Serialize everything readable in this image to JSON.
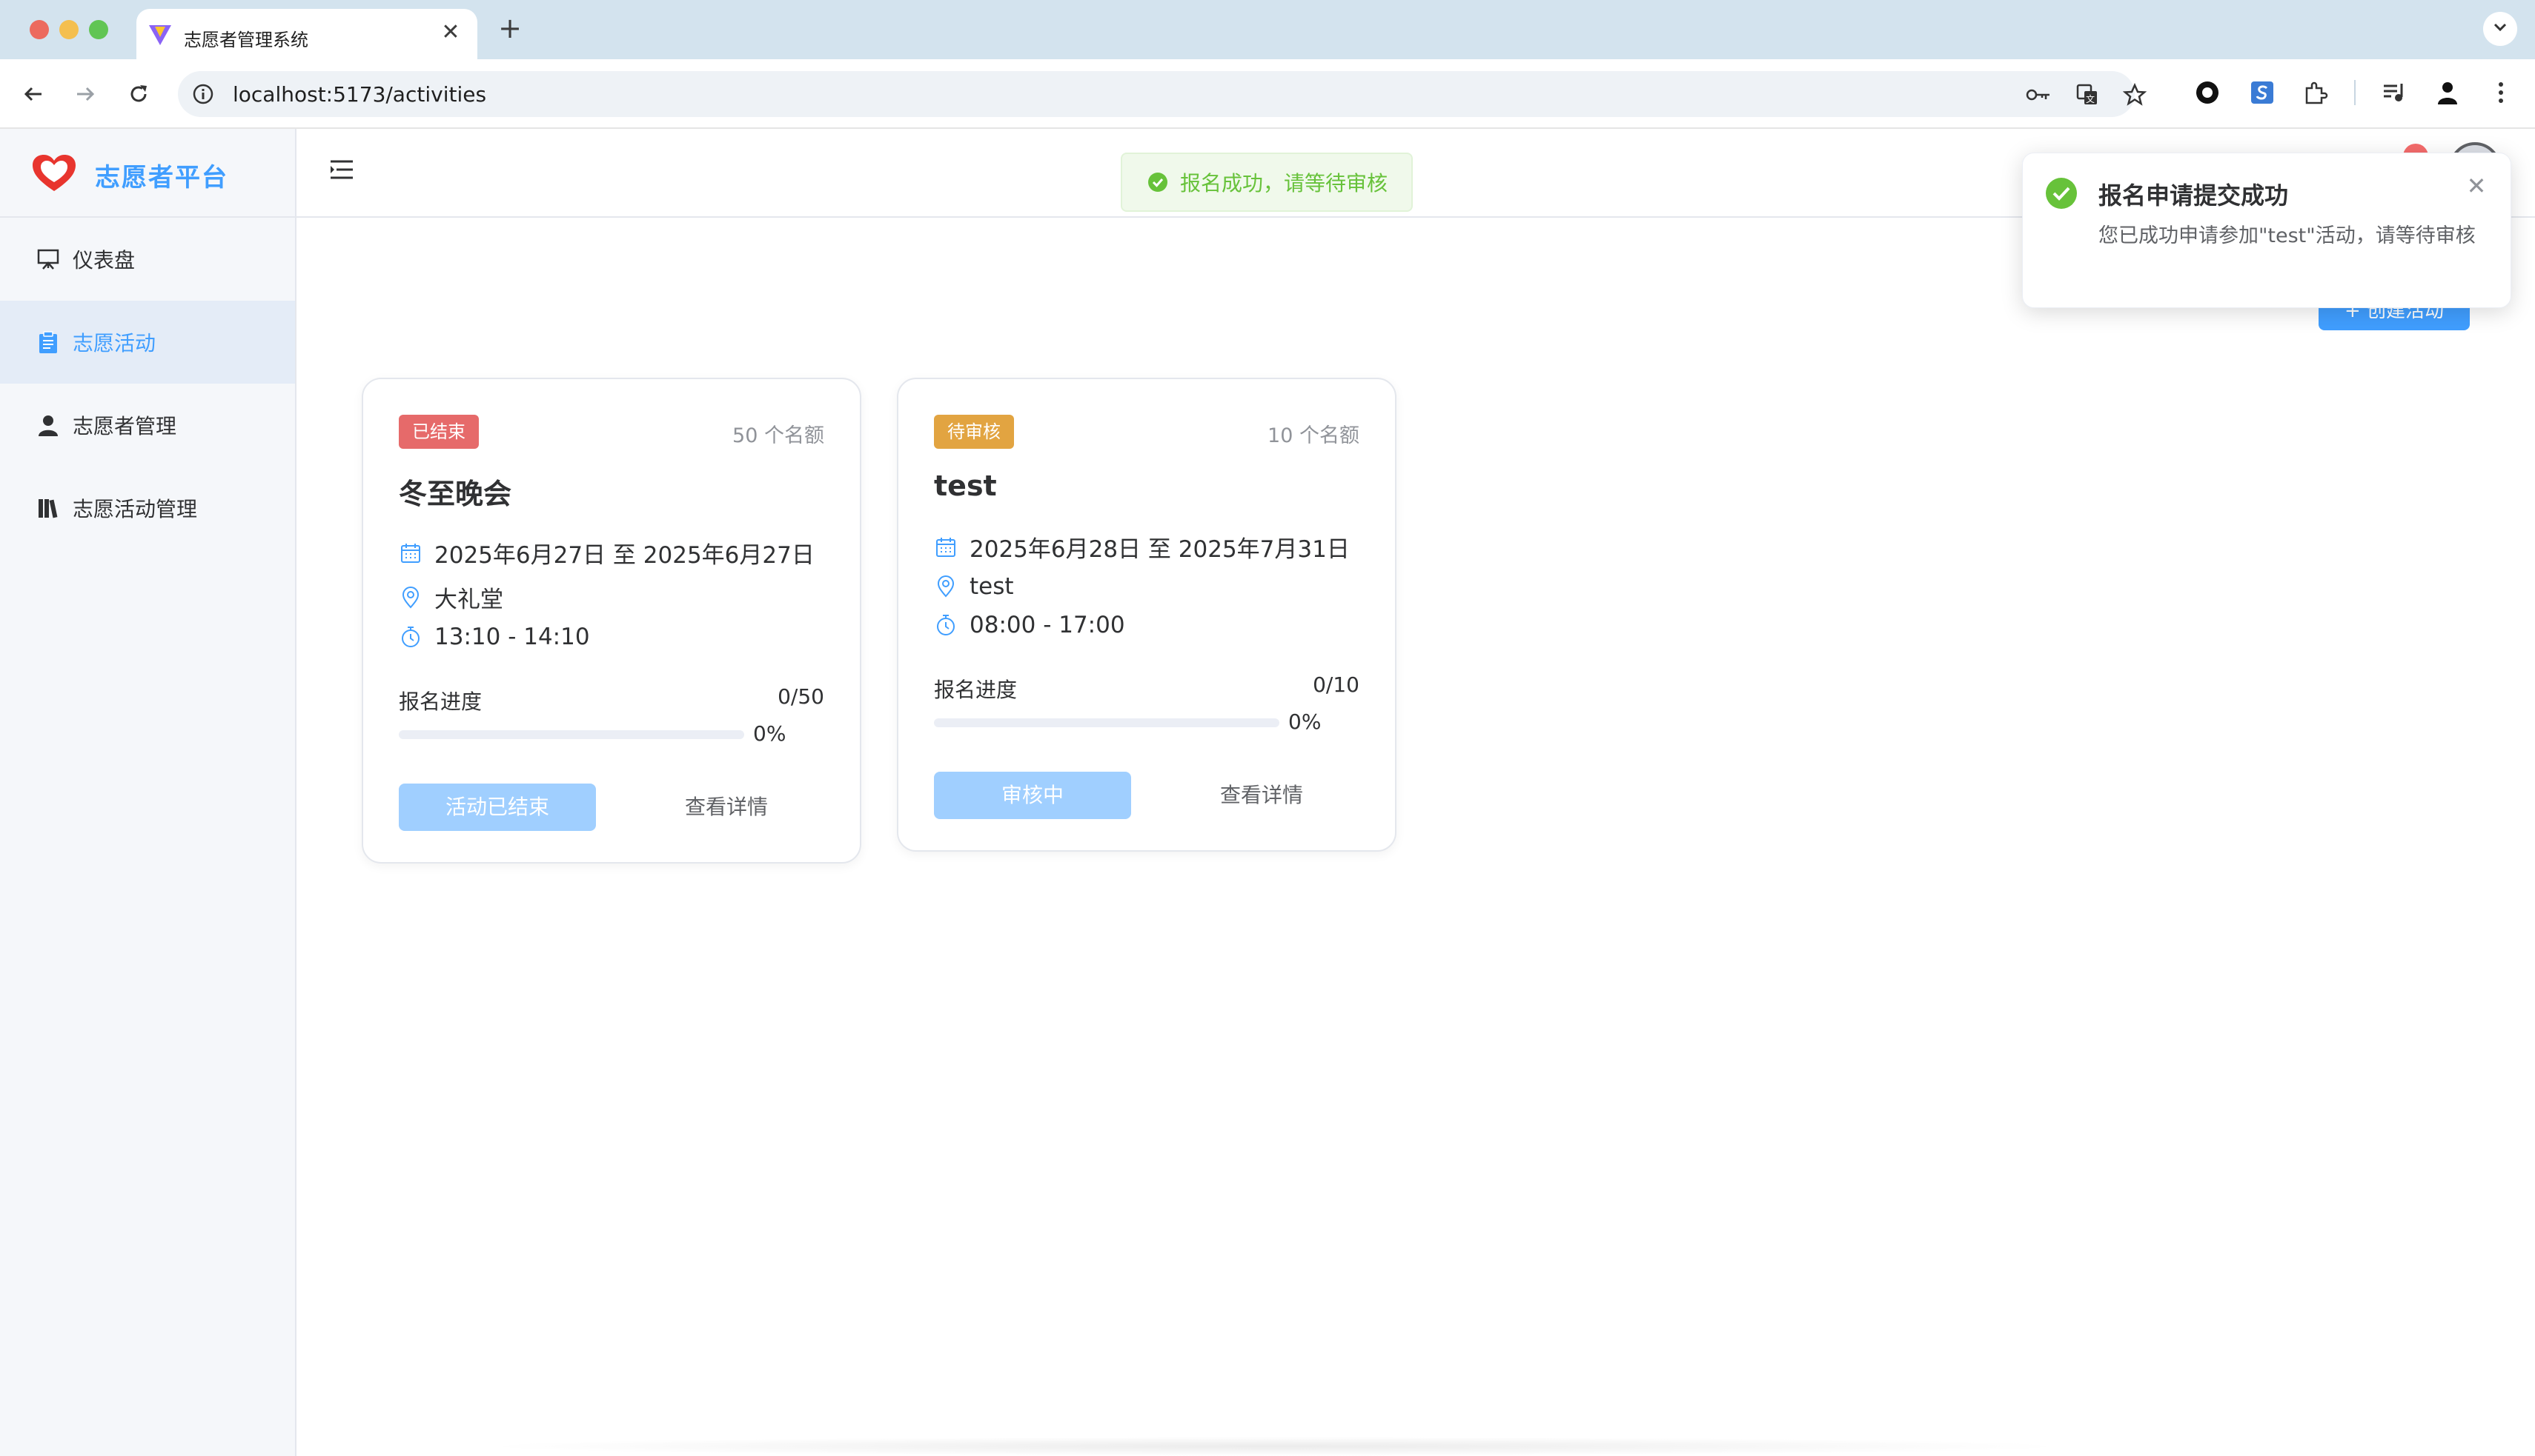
{
  "browser": {
    "tab_title": "志愿者管理系统",
    "tab_close": "✕",
    "new_tab": "+",
    "url": "localhost:5173/activities"
  },
  "sidebar": {
    "logo_text": "志愿者平台",
    "items": [
      {
        "label": "仪表盘",
        "icon": "dashboard-icon",
        "active": false
      },
      {
        "label": "志愿活动",
        "icon": "clipboard-icon",
        "active": true
      },
      {
        "label": "志愿者管理",
        "icon": "user-icon",
        "active": false
      },
      {
        "label": "志愿活动管理",
        "icon": "books-icon",
        "active": false
      }
    ]
  },
  "main": {
    "create_button": "+ 创建活动"
  },
  "cards": [
    {
      "status": "已结束",
      "status_color": "#e66a6a",
      "quota": "50 个名额",
      "title": "冬至晚会",
      "date": "2025年6月27日 至 2025年6月27日",
      "location": "大礼堂",
      "time": "13:10 - 14:10",
      "progress_label": "报名进度",
      "progress_count": "0/50",
      "progress_fraction": 0,
      "progress_pct": "0%",
      "action_button": "活动已结束",
      "detail_link": "查看详情"
    },
    {
      "status": "待审核",
      "status_color": "#e2a441",
      "quota": "10 个名额",
      "title": "test",
      "date": "2025年6月28日 至 2025年7月31日",
      "location": "test",
      "time": "08:00 - 17:00",
      "progress_label": "报名进度",
      "progress_count": "0/10",
      "progress_fraction": 0,
      "progress_pct": "0%",
      "action_button": "审核中",
      "detail_link": "查看详情"
    }
  ],
  "message": {
    "text": "报名成功，请等待审核",
    "color": "#67c23a"
  },
  "notification": {
    "title": "报名申请提交成功",
    "body": "您已成功申请参加\"test\"活动，请等待审核",
    "close": "✕"
  },
  "colors": {
    "primary": "#409eff",
    "success": "#67c23a"
  }
}
